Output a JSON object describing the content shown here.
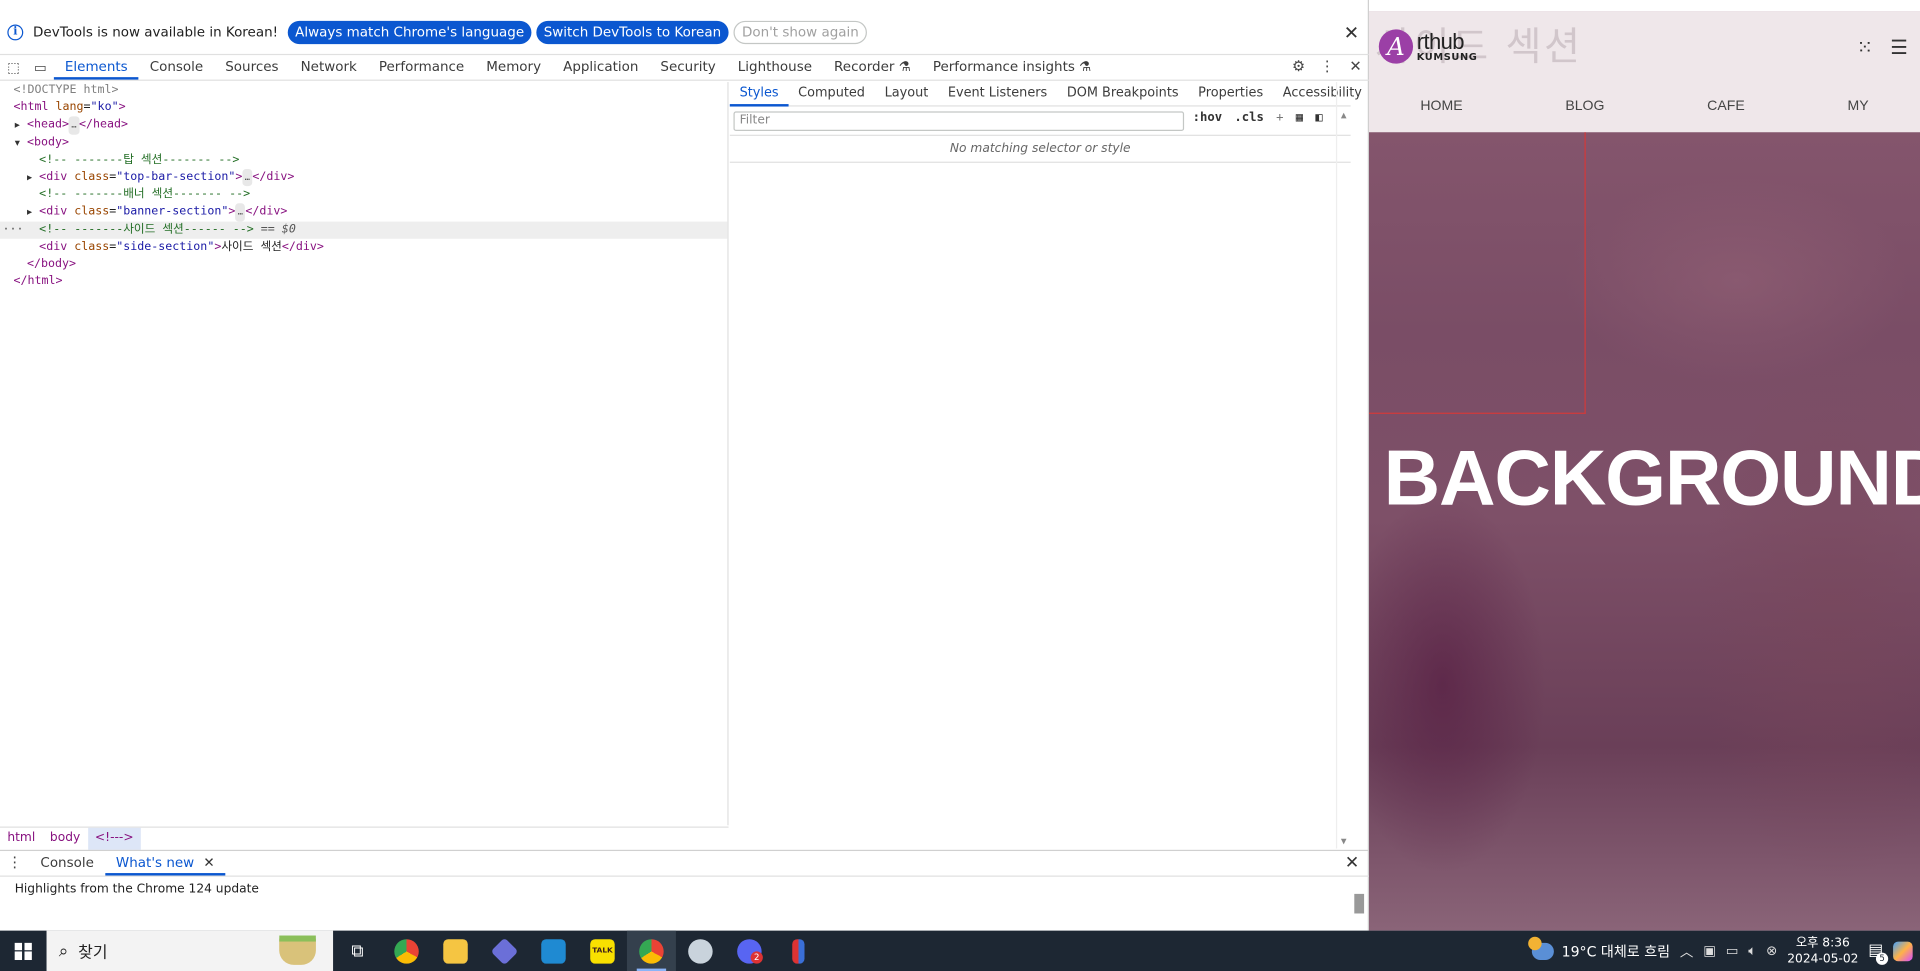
{
  "infobar": {
    "message": "DevTools is now available in Korean!",
    "btn_match": "Always match Chrome's language",
    "btn_switch": "Switch DevTools to Korean",
    "btn_dont": "Don't show again",
    "close": "✕"
  },
  "main_tabs": [
    "Elements",
    "Console",
    "Sources",
    "Network",
    "Performance",
    "Memory",
    "Application",
    "Security",
    "Lighthouse",
    "Recorder ⚗",
    "Performance insights ⚗"
  ],
  "tree": {
    "doctype": "<!DOCTYPE html>",
    "html_open_tag": "<html",
    "html_lang_attr": " lang",
    "html_lang_val": "\"ko\"",
    "html_close_bracket": ">",
    "head": "<head>",
    "head_close": "</head>",
    "body_open": "<body>",
    "comment_top": "<!-- -------탑 섹션------- -->",
    "div_open": "<div",
    "class_attr": " class",
    "top_bar_class": "\"top-bar-section\"",
    "gt": ">",
    "div_close": "</div>",
    "comment_banner": "<!-- -------배너 섹션------- -->",
    "banner_class": "\"banner-section\"",
    "comment_side": "<!-- -------사이드 섹션------ -->",
    "eq_marker": "== $0",
    "side_class": "\"side-section\"",
    "side_text": "사이드 섹션",
    "body_close": "</body>",
    "html_close": "</html>",
    "ellipsis": "…",
    "gutter": "···"
  },
  "breadcrumbs": [
    "html",
    "body",
    "<!--->"
  ],
  "styles": {
    "subtabs": [
      "Styles",
      "Computed",
      "Layout",
      "Event Listeners",
      "DOM Breakpoints",
      "Properties",
      "Accessibility"
    ],
    "filter_placeholder": "Filter",
    "hov": ":hov",
    "cls": ".cls",
    "plus": "+",
    "no_match": "No matching selector or style"
  },
  "drawer": {
    "tabs": [
      "Console",
      "What's new"
    ],
    "active_tab_close": "✕",
    "content": "Highlights from the Chrome 124 update"
  },
  "preview": {
    "ghost_text": "사이드 섹션",
    "logo_letter": "A",
    "logo_name": "rthub",
    "logo_sub": "KUMSUNG",
    "nav": [
      "HOME",
      "BLOG",
      "CAFE",
      "MY"
    ],
    "hero_title": "BACKGROUND"
  },
  "taskbar": {
    "search_label": "찾기",
    "weather": "19°C  대체로 흐림",
    "time": "오후 8:36",
    "date": "2024-05-02",
    "notif_count": "5",
    "discord_badge": "2"
  },
  "colors": {
    "accent": "#0b57d0",
    "taskbar": "#1d2733",
    "preview_bg": "#7a4d66"
  }
}
